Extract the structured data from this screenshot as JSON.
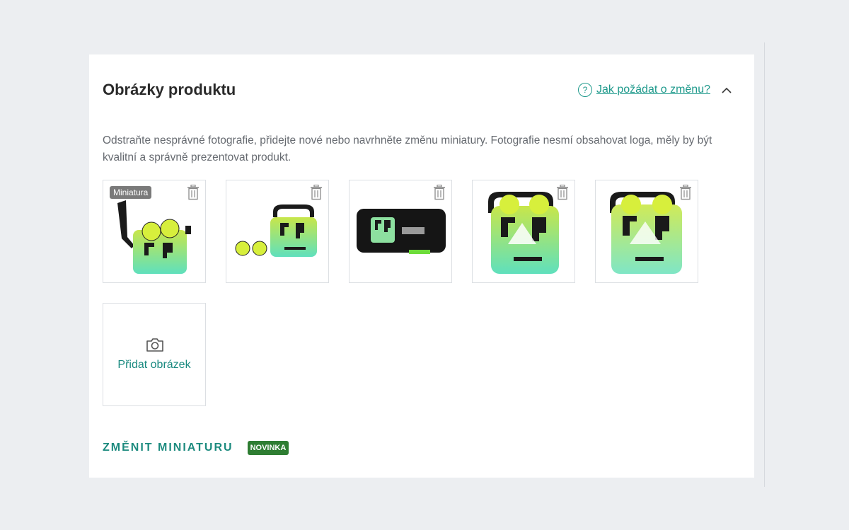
{
  "section": {
    "title": "Obrázky produktu",
    "help_link": "Jak požádat o změnu?",
    "description": "Odstraňte nesprávné fotografie, přidejte nové nebo navrhněte změnu miniatury. Fotografie nesmí obsahovat loga, měly by být kvalitní a správně prezentovat produkt."
  },
  "images": [
    {
      "badge": "Miniatura",
      "icon": "trash-icon"
    },
    {
      "icon": "trash-icon"
    },
    {
      "icon": "trash-icon"
    },
    {
      "icon": "trash-icon"
    },
    {
      "icon": "trash-icon"
    }
  ],
  "add_image": {
    "label": "Přidat obrázek",
    "icon": "camera-icon"
  },
  "footer": {
    "change_thumbnail": "ZMĚNIT MINIATURU",
    "new_badge": "NOVINKA"
  },
  "colors": {
    "accent": "#1f9a8c",
    "badge_green": "#2e7d32",
    "background": "#eceef1"
  }
}
